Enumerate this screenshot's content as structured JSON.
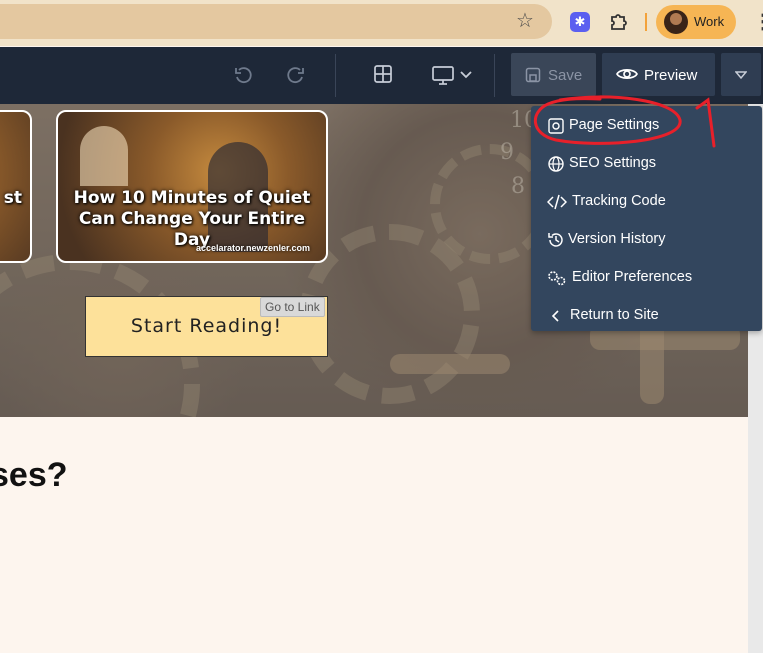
{
  "browser": {
    "profile_label": "Work",
    "star_icon": "star-icon",
    "extension_icon": "extension-icon"
  },
  "toolbar": {
    "save_label": "Save",
    "preview_label": "Preview"
  },
  "hero": {
    "card_left_title": "st",
    "card_right_title_line1": "How 10 Minutes of Quiet",
    "card_right_title_line2": "Can Change Your Entire Day",
    "card_right_credit": "accelarator.newzenler.com",
    "cta_label": "Start Reading!",
    "tooltip": "Go to Link",
    "clock_numbers": [
      "10",
      "9",
      "8"
    ]
  },
  "content": {
    "heading_fragment": "ses?"
  },
  "menu": {
    "items": [
      {
        "label": "Page Settings",
        "icon": "gear-page-icon"
      },
      {
        "label": "SEO Settings",
        "icon": "globe-icon"
      },
      {
        "label": "Tracking Code",
        "icon": "code-icon"
      },
      {
        "label": "Version History",
        "icon": "history-icon"
      },
      {
        "label": "Editor Preferences",
        "icon": "gears-icon"
      },
      {
        "label": "Return to Site",
        "icon": "chevron-left-icon"
      }
    ]
  },
  "annotation": {
    "number": "1",
    "color": "#e8202a"
  },
  "colors": {
    "toolbar_bg": "#1e2838",
    "menu_bg": "#33465e",
    "cta_bg": "#fde19a"
  }
}
